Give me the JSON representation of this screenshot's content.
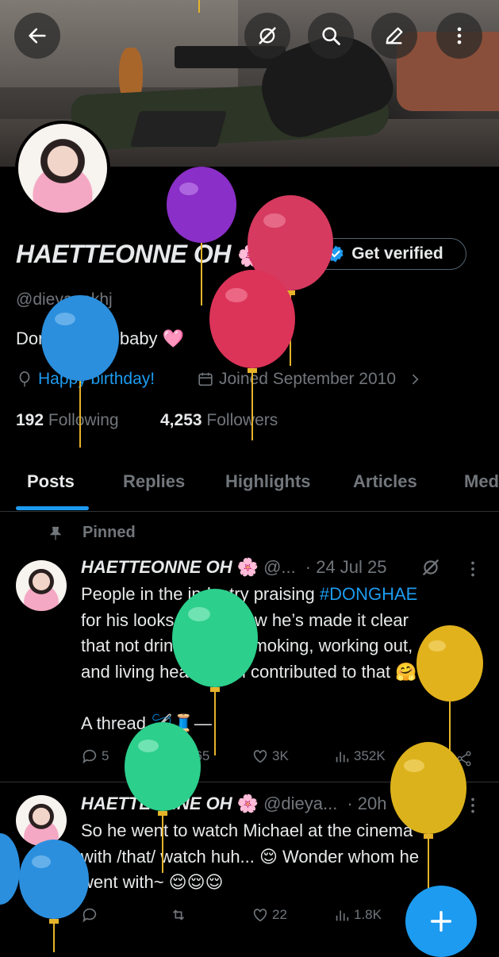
{
  "profile": {
    "display_name": "HAETTEONNE OH",
    "name_emoji": "🌸",
    "handle": "@dieyanakhj",
    "bio_text": "Donghae my baby",
    "bio_emoji": "🩷",
    "location": "Happy birthday!",
    "joined": "Joined September 2010",
    "following_count": "192",
    "following_label": "Following",
    "followers_count": "4,253",
    "followers_label": "Followers",
    "get_verified_label": "Get verified"
  },
  "tabs": [
    {
      "label": "Posts"
    },
    {
      "label": "Replies"
    },
    {
      "label": "Highlights"
    },
    {
      "label": "Articles"
    },
    {
      "label": "Media"
    }
  ],
  "pinned_label": "Pinned",
  "tweets": [
    {
      "name": "HAETTEONNE OH",
      "emoji": "🌸",
      "handle": "@...",
      "date": "· 24 Jul 25",
      "text_before": "People in the industry praising ",
      "hashtag": "#DONGHAE",
      "text_after": "\nfor his looks — and how he’s made it clear\nthat not drinking, not smoking, working out,\nand living healthily all contributed to that 🤗\n\nA thread 🪡🧵—",
      "replies": "5",
      "retweets": "765",
      "likes": "3K",
      "views": "352K"
    },
    {
      "name": "HAETTEONNE OH",
      "emoji": "🌸",
      "handle": "@dieya...",
      "date": "· 20h",
      "text": "So he went to watch Michael at the cinema\nwith /that/ watch huh... 😌 Wonder whom he\nwent with~ 😌😌😌",
      "replies": "",
      "retweets": "",
      "likes": "22",
      "views": "1.8K"
    }
  ],
  "icons": {
    "back": "arrow-left-icon",
    "grok": "grok-icon",
    "search": "search-icon",
    "edit": "edit-icon",
    "more": "more-vertical-icon",
    "compose": "plus-icon"
  },
  "colors": {
    "accent": "#1d9bf0",
    "muted": "#71767b",
    "background": "#000000",
    "text": "#e7e9ea"
  }
}
